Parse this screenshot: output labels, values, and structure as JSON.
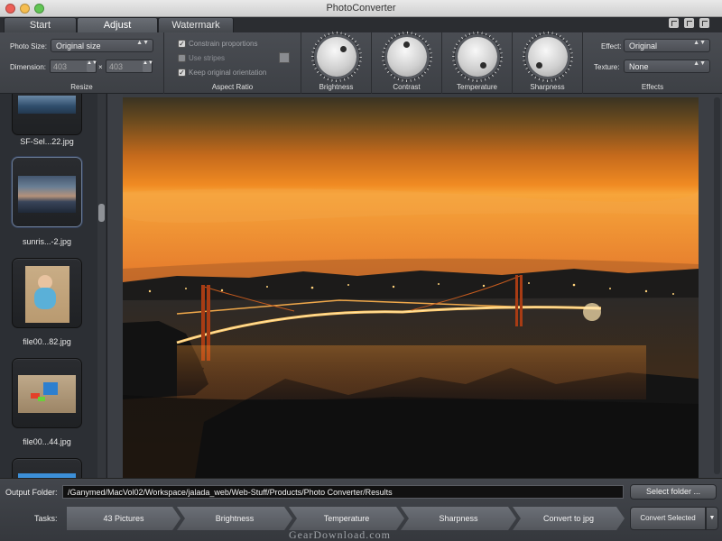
{
  "window": {
    "title": "PhotoConverter",
    "traffic_lights": [
      "#ec5f57",
      "#f5bd4f",
      "#61c554"
    ]
  },
  "tabs": [
    {
      "label": "Start",
      "active": false
    },
    {
      "label": "Adjust",
      "active": true
    },
    {
      "label": "Watermark",
      "active": false
    }
  ],
  "toolbar": {
    "resize": {
      "photo_size_label": "Photo Size:",
      "photo_size_value": "Original size",
      "dimension_label": "Dimension:",
      "width": "403",
      "times": "×",
      "height": "403",
      "section_label": "Resize"
    },
    "aspect_ratio": {
      "constrain_proportions": {
        "label": "Constrain proportions",
        "checked": true
      },
      "use_stripes": {
        "label": "Use stripes",
        "checked": false
      },
      "keep_orientation": {
        "label": "Keep original orientation",
        "checked": true
      },
      "check_mark": "✓",
      "section_label": "Aspect Ratio"
    },
    "knobs": [
      {
        "label": "Brightness",
        "icon": "knob-icon"
      },
      {
        "label": "Contrast",
        "icon": "knob-icon"
      },
      {
        "label": "Temperature",
        "icon": "knob-icon"
      },
      {
        "label": "Sharpness",
        "icon": "knob-icon"
      }
    ],
    "effects": {
      "effect_label": "Effect:",
      "effect_value": "Original",
      "texture_label": "Texture:",
      "texture_value": "None",
      "section_label": "Effects"
    },
    "dropdown_arrows": "▲▼"
  },
  "sidebar": {
    "items": [
      {
        "name": "SF-Sel...22.jpg",
        "selected": false
      },
      {
        "name": "sunris...-2.jpg",
        "selected": true
      },
      {
        "name": "file00...82.jpg",
        "selected": false
      },
      {
        "name": "file00...44.jpg",
        "selected": false
      }
    ]
  },
  "bottom": {
    "output_folder_label": "Output Folder:",
    "output_folder_path": "/Ganymed/MacVol02/Workspace/jalada_web/Web-Stuff/Products/Photo Converter/Results",
    "select_folder_button": "Select folder ...",
    "tasks_label": "Tasks:",
    "tasks": [
      "43 Pictures",
      "Brightness",
      "Temperature",
      "Sharpness",
      "Convert to jpg"
    ],
    "convert_button": "Convert Selected",
    "convert_dropdown": "▼"
  },
  "watermark": "GearDownload.com"
}
